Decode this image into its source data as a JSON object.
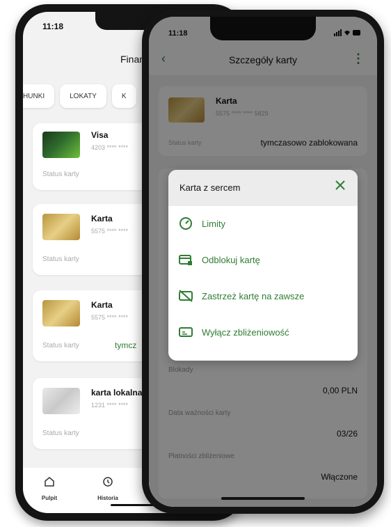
{
  "back_screen": {
    "time": "11:18",
    "header_title": "Finan",
    "tabs": [
      "HUNKI",
      "LOKATY",
      "K"
    ],
    "cards": [
      {
        "name": "Visa",
        "number": "4203 **** ****",
        "status_label": "Status karty",
        "status_value": ""
      },
      {
        "name": "Karta",
        "number": "5575 **** ****",
        "status_label": "Status karty",
        "status_value": ""
      },
      {
        "name": "Karta",
        "number": "5575 **** ****",
        "status_label": "Status karty",
        "status_value": "tymcz"
      },
      {
        "name": "karta lokalna",
        "number": "1231 **** ****",
        "status_label": "Status karty",
        "status_value": ""
      }
    ],
    "nav": [
      {
        "label": "Pulpit",
        "icon": "home-icon"
      },
      {
        "label": "Historia",
        "icon": "history-icon"
      }
    ]
  },
  "front_screen": {
    "time": "11:18",
    "title": "Szczegóły karty",
    "card": {
      "name": "Karta",
      "number": "5575 **** **** 5829",
      "status_label": "Status karty",
      "status_value": "tymczasowo zablokowana"
    },
    "details": [
      {
        "label": "Blokady",
        "value": "0,00 PLN"
      },
      {
        "label": "Data ważności karty",
        "value": "03/26"
      },
      {
        "label": "Płatności zbliżeniowe",
        "value": "Włączone"
      }
    ]
  },
  "modal": {
    "title": "Karta z sercem",
    "items": [
      {
        "label": "Limity",
        "icon": "gauge-icon"
      },
      {
        "label": "Odblokuj kartę",
        "icon": "card-unlock-icon"
      },
      {
        "label": "Zastrzeż kartę na zawsze",
        "icon": "card-block-icon"
      },
      {
        "label": "Wyłącz zbliżeniowość",
        "icon": "contactless-card-icon"
      }
    ]
  },
  "colors": {
    "accent": "#2e7d32",
    "overlay": "#000000"
  }
}
